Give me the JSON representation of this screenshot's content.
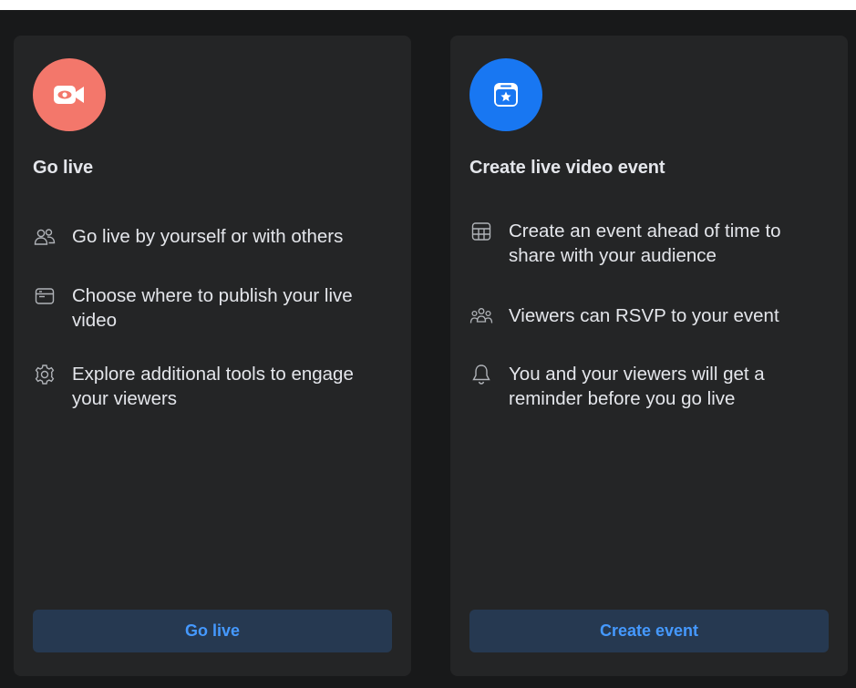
{
  "cards": [
    {
      "icon": "video-camera-icon",
      "icon_bg": "#f3776b",
      "title": "Go live",
      "features": [
        {
          "icon": "people-icon",
          "text": "Go live by yourself or with others"
        },
        {
          "icon": "window-icon",
          "text": "Choose where to publish your live video"
        },
        {
          "icon": "gear-icon",
          "text": "Explore additional tools to engage your viewers"
        }
      ],
      "button_label": "Go live"
    },
    {
      "icon": "calendar-star-icon",
      "icon_bg": "#1877f2",
      "title": "Create live video event",
      "features": [
        {
          "icon": "calendar-icon",
          "text": "Create an event ahead of time to share with your audience"
        },
        {
          "icon": "group-icon",
          "text": "Viewers can RSVP to your event"
        },
        {
          "icon": "bell-icon",
          "text": "You and your viewers will get a reminder before you go live"
        }
      ],
      "button_label": "Create event"
    }
  ],
  "colors": {
    "background": "#18191a",
    "card": "#242526",
    "text": "#e4e6eb",
    "button_bg": "#263951",
    "button_text": "#4599ff"
  }
}
